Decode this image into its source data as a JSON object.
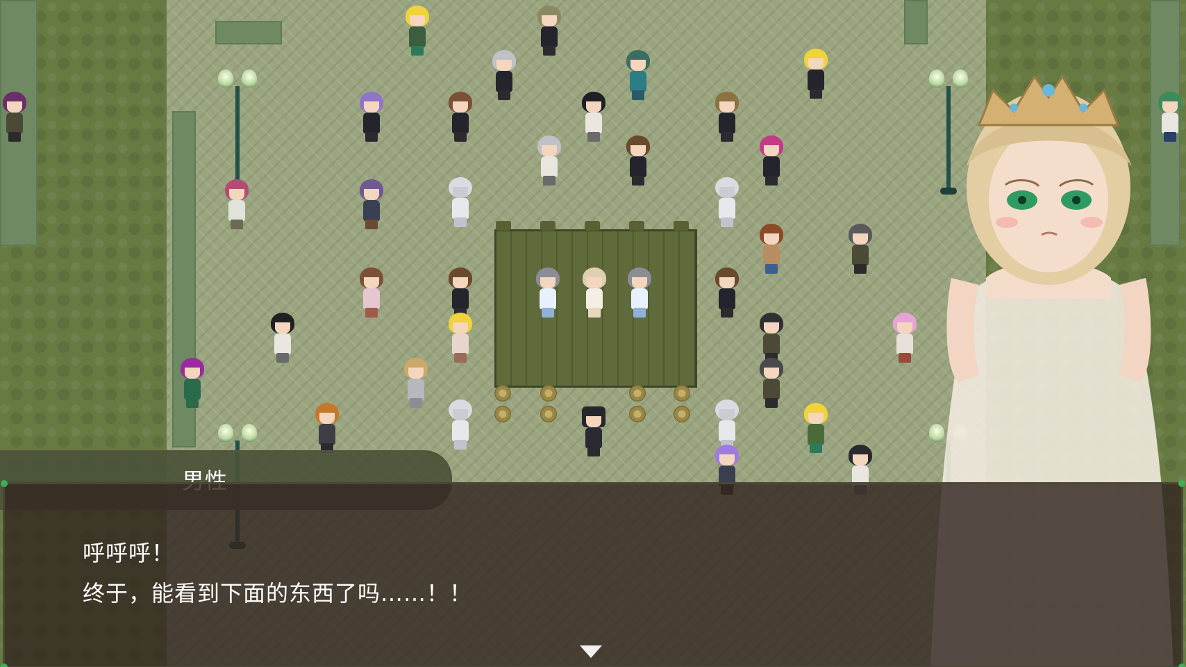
{
  "dialog": {
    "speaker": "男性",
    "lines": [
      "呼呼呼！",
      "终于，能看到下面的东西了吗……！！"
    ],
    "advance_icon": "triangle-down-icon"
  },
  "colors": {
    "nameplate_bg": "#4a5238",
    "dialog_bg": "#342822",
    "text": "#ffffff",
    "grass": "#667a42",
    "plaza": "#9aa57f"
  }
}
